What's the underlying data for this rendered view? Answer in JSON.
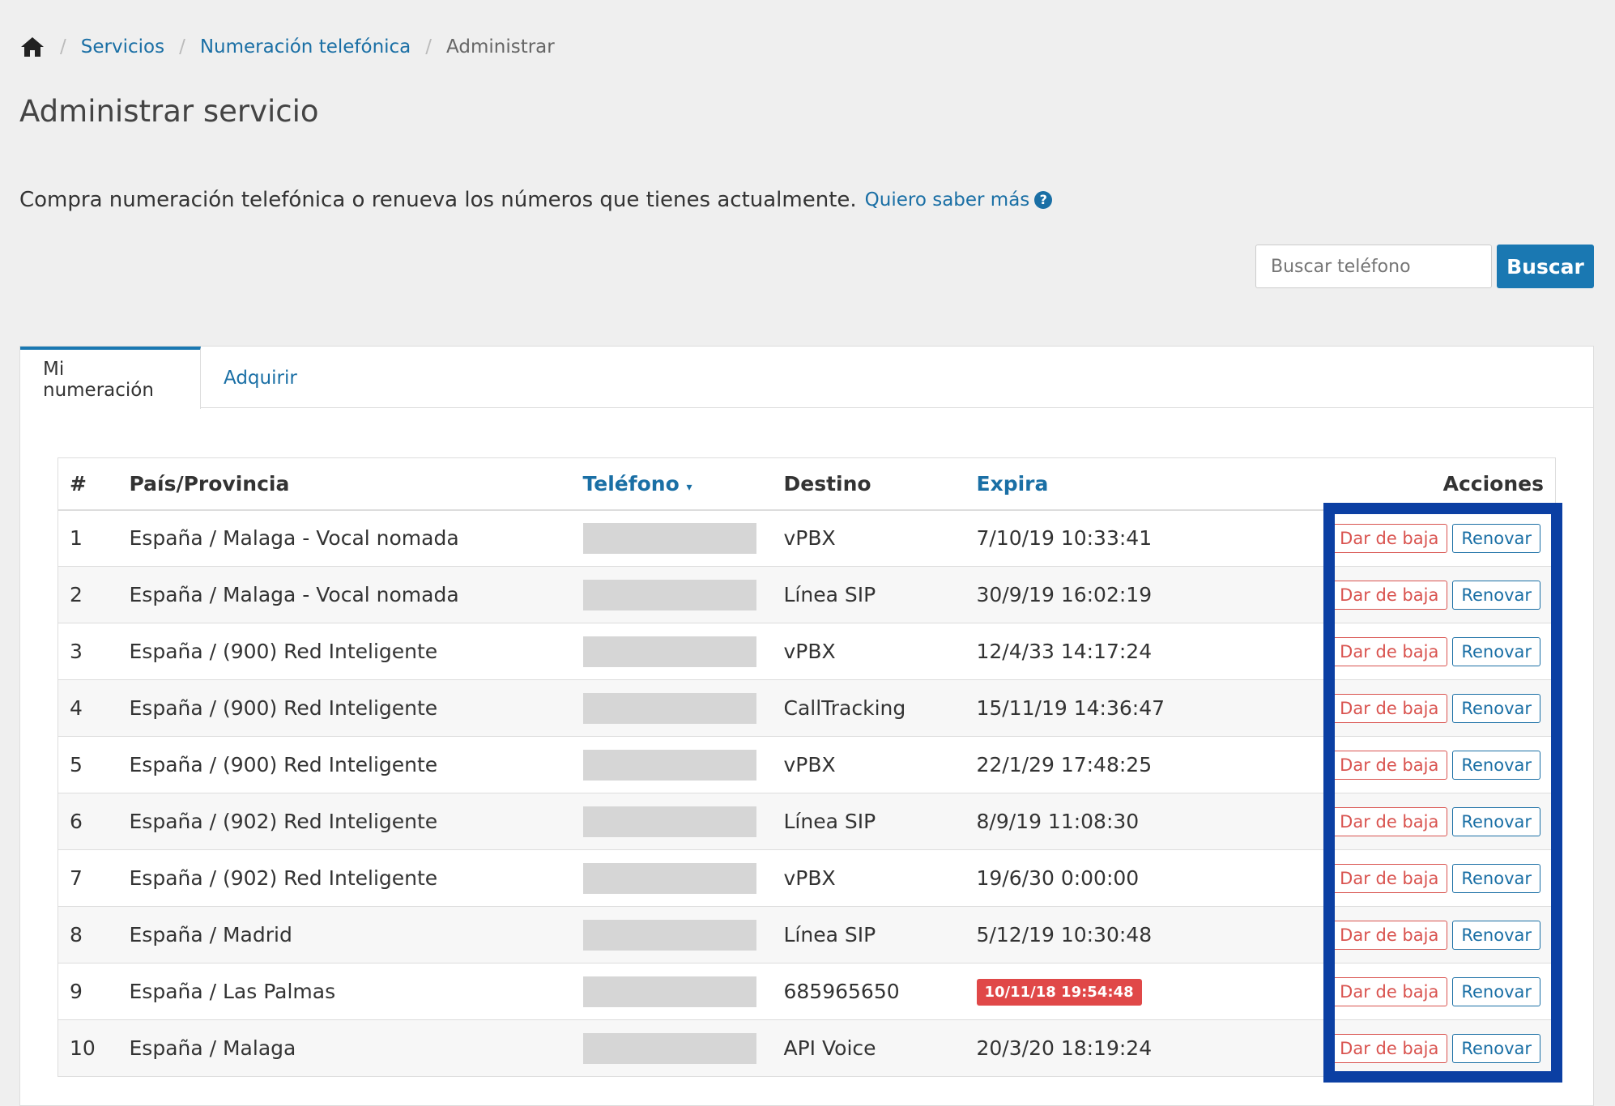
{
  "breadcrumb": {
    "home_icon": "home-icon",
    "items": [
      "Servicios",
      "Numeración telefónica"
    ],
    "current": "Administrar"
  },
  "page_title": "Administrar servicio",
  "intro": {
    "text": "Compra numeración telefónica o renueva los números que tienes actualmente.",
    "link": "Quiero saber más",
    "help_icon": "question-circle-icon"
  },
  "search": {
    "placeholder": "Buscar teléfono",
    "button": "Buscar"
  },
  "tabs": [
    "Mi numeración",
    "Adquirir"
  ],
  "table": {
    "headers": {
      "num": "#",
      "pais": "País/Provincia",
      "telefono": "Teléfono",
      "destino": "Destino",
      "expira": "Expira",
      "acciones": "Acciones"
    },
    "rows": [
      {
        "num": "1",
        "pais": "España / Malaga - Vocal nomada",
        "destino": "vPBX",
        "expira": "7/10/19 10:33:41"
      },
      {
        "num": "2",
        "pais": "España / Malaga - Vocal nomada",
        "destino": "Línea SIP",
        "expira": "30/9/19 16:02:19"
      },
      {
        "num": "3",
        "pais": "España / (900) Red Inteligente",
        "destino": "vPBX",
        "expira": "12/4/33 14:17:24"
      },
      {
        "num": "4",
        "pais": "España / (900) Red Inteligente",
        "destino": "CallTracking",
        "expira": "15/11/19 14:36:47"
      },
      {
        "num": "5",
        "pais": "España / (900) Red Inteligente",
        "destino": "vPBX",
        "expira": "22/1/29 17:48:25"
      },
      {
        "num": "6",
        "pais": "España / (902) Red Inteligente",
        "destino": "Línea SIP",
        "expira": "8/9/19 11:08:30"
      },
      {
        "num": "7",
        "pais": "España / (902) Red Inteligente",
        "destino": "vPBX",
        "expira": "19/6/30 0:00:00"
      },
      {
        "num": "8",
        "pais": "España / Madrid",
        "destino": "Línea SIP",
        "expira": "5/12/19 10:30:48"
      },
      {
        "num": "9",
        "pais": "España / Las Palmas",
        "destino": "685965650",
        "expira": "10/11/18 19:54:48",
        "expired": true
      },
      {
        "num": "10",
        "pais": "España / Malaga",
        "destino": "API Voice",
        "expira": "20/3/20 18:19:24"
      }
    ],
    "action_baja": "Dar de baja",
    "action_renovar": "Renovar"
  },
  "colors": {
    "accent": "#1a78b2",
    "link": "#1a6fa5",
    "danger": "#d9534f",
    "highlight": "#0b3fa3"
  }
}
